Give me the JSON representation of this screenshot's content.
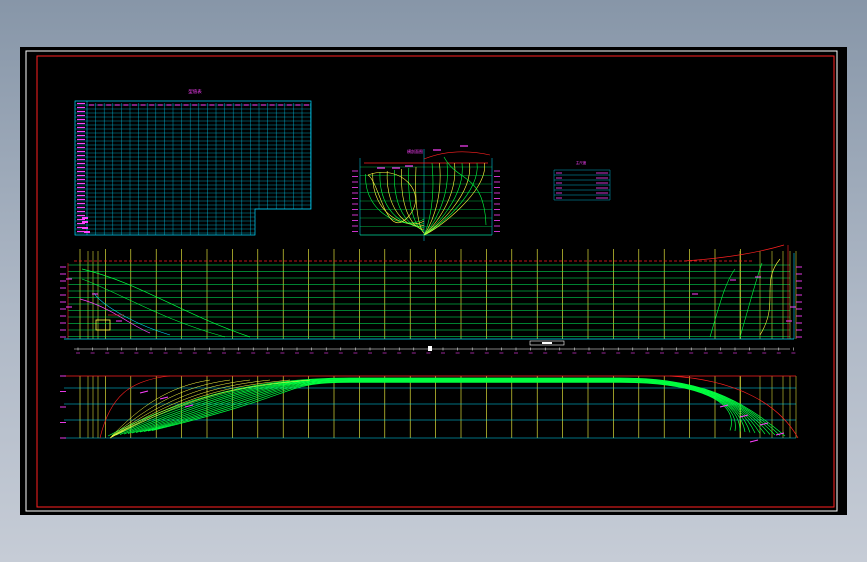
{
  "drawing": {
    "table_title": "型值表",
    "bodyplan_title": "横剖面图",
    "legend_title": "主尺度",
    "legend_rows": [
      "",
      "",
      "",
      "",
      ""
    ]
  },
  "colors": {
    "background": "#000000",
    "frame": "#ff2020",
    "table_lines": "#00d8ff",
    "table_text": "#ff40ff",
    "hull_lines": "#00ff40",
    "stations": "#ffff40",
    "waterlines": "#00ff60",
    "buttock": "#ffff00",
    "annotations": "#ff40ff",
    "baseline": "#ffffff",
    "cyan": "#00e0ff"
  }
}
